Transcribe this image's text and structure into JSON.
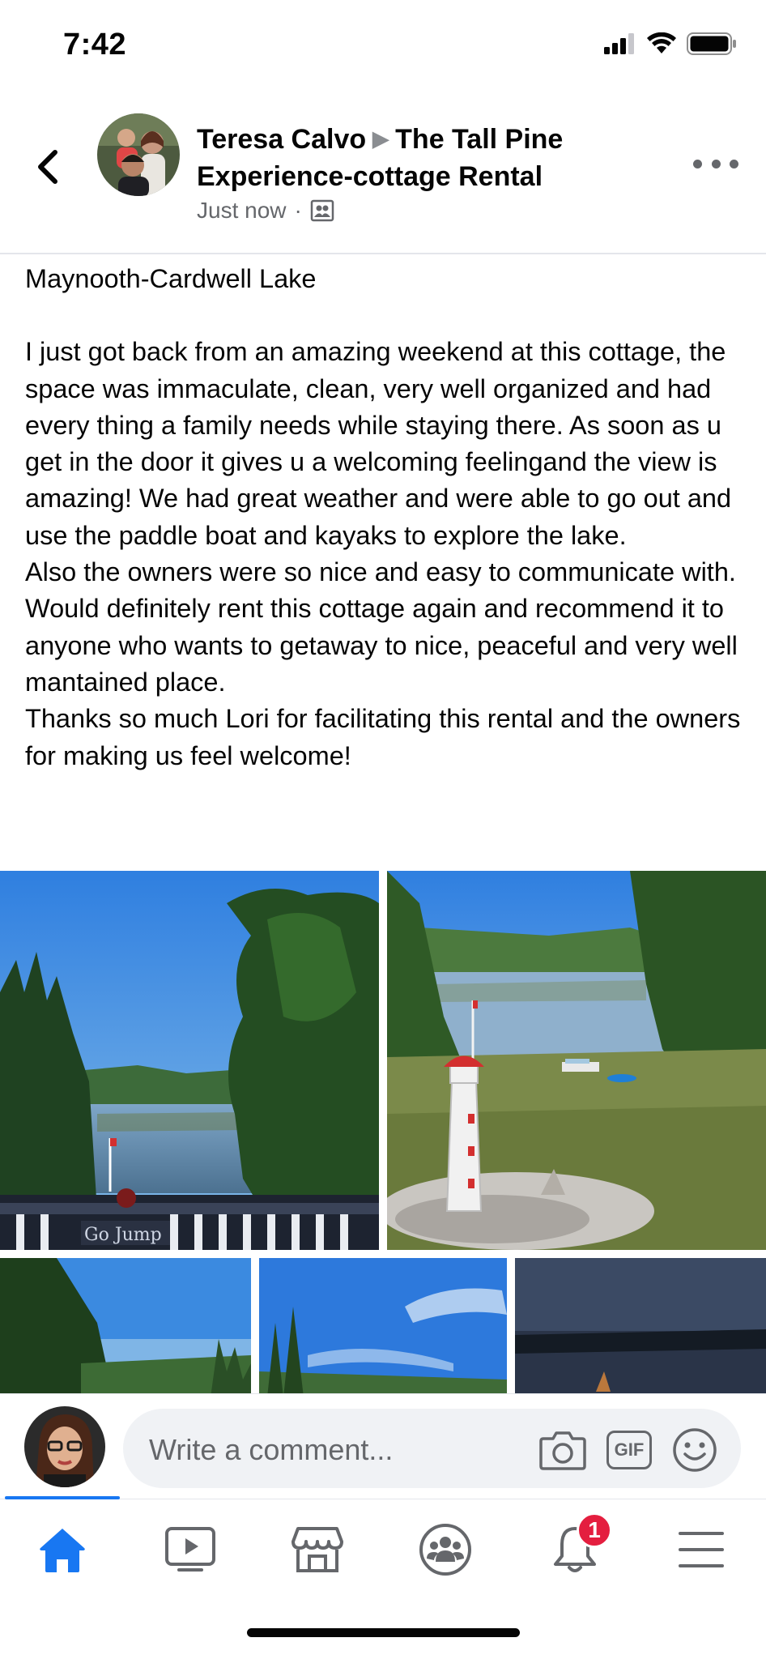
{
  "status_bar": {
    "time": "7:42"
  },
  "post": {
    "author": "Teresa Calvo",
    "group": "The Tall Pine Experience-cottage Rental",
    "timestamp": "Just now",
    "location": "Maynooth-Cardwell Lake",
    "body": "I just got back from an amazing weekend at this cottage, the space was immaculate, clean, very well organized and had every thing a family needs while staying there. As soon as u get in the door it gives u a welcoming feelingand the view is amazing! We had great weather and were able to go out and use the paddle boat and kayaks to explore the lake.\nAlso the owners were so nice and easy to communicate with.\nWould definitely rent this cottage again and recommend it to anyone who wants to getaway to nice, peaceful and very well mantained place.\nThanks so much Lori for facilitating this rental and the owners for making us feel welcome!",
    "photos": [
      {
        "name": "photo-deck-lake-view",
        "sign_text": "Go Jump"
      },
      {
        "name": "photo-lighthouse-shore"
      },
      {
        "name": "photo-treeline-sky"
      },
      {
        "name": "photo-clouds-sky"
      },
      {
        "name": "photo-lake-dusk"
      }
    ]
  },
  "comment_bar": {
    "placeholder": "Write a comment...",
    "gif_label": "GIF"
  },
  "tab_bar": {
    "items": [
      {
        "name": "home",
        "active": true
      },
      {
        "name": "watch"
      },
      {
        "name": "marketplace"
      },
      {
        "name": "groups"
      },
      {
        "name": "notifications",
        "badge": "1"
      },
      {
        "name": "menu"
      }
    ]
  },
  "colors": {
    "accent": "#1877f2",
    "badge": "#e41e3f",
    "secondary_text": "#65676b",
    "input_bg": "#f0f2f5"
  }
}
